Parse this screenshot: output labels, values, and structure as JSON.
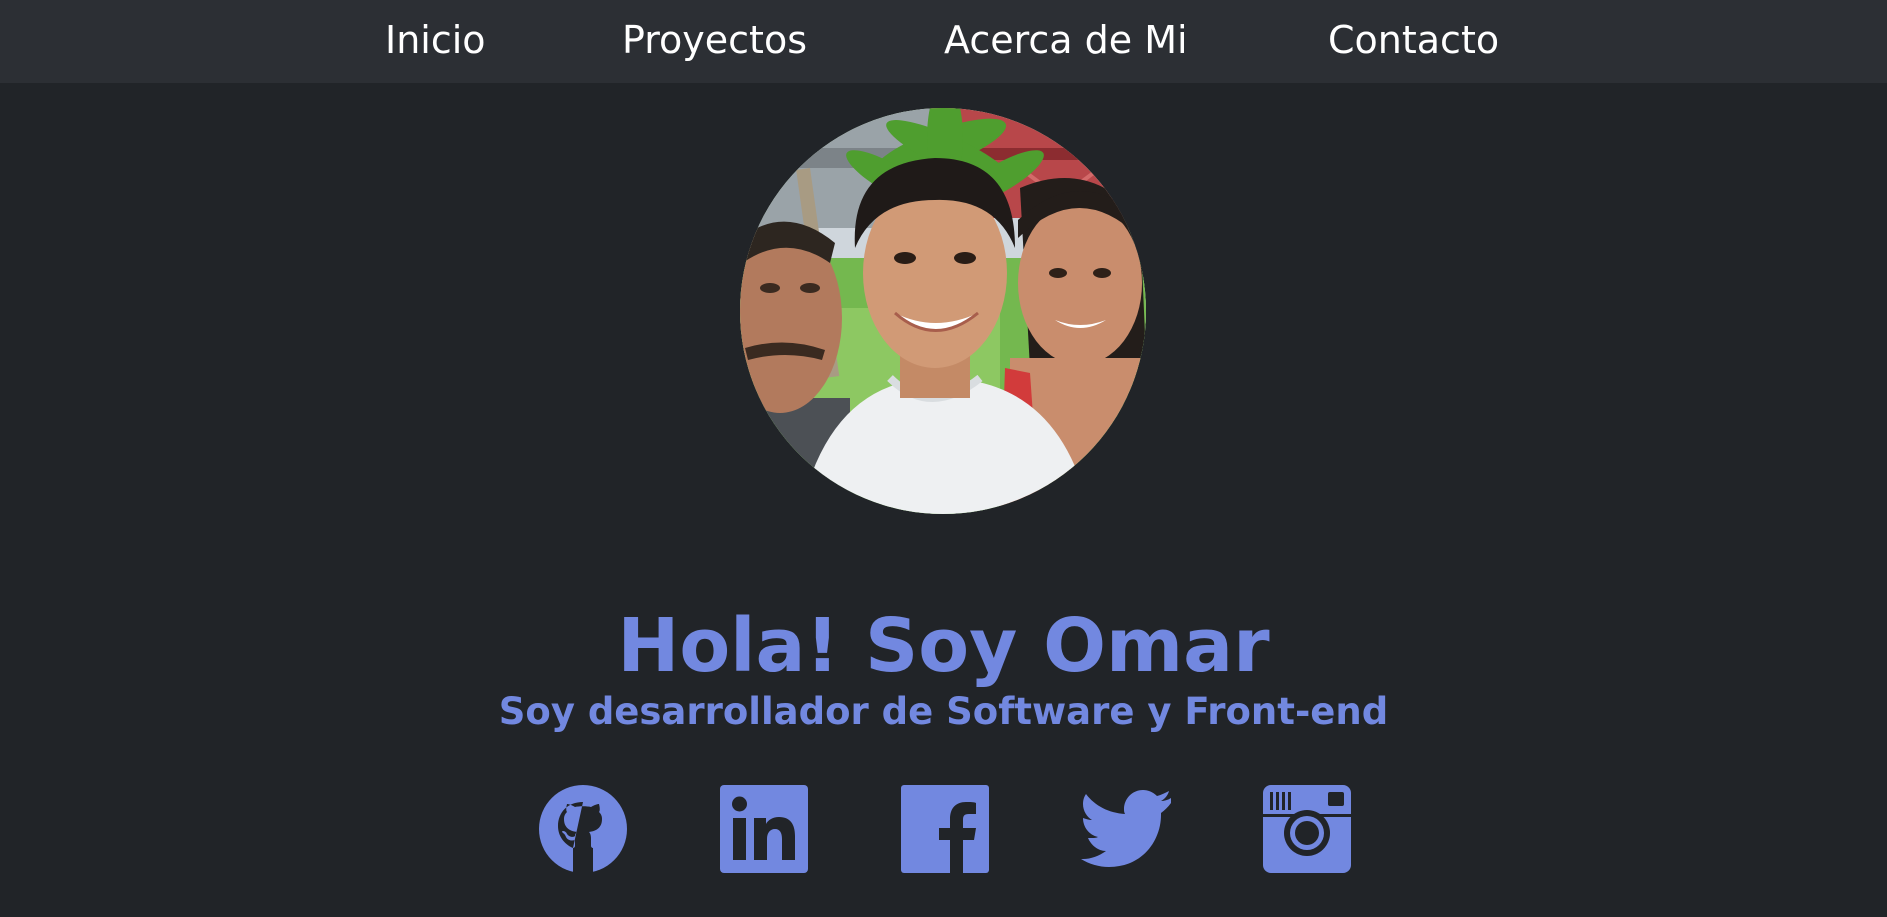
{
  "nav": {
    "items": [
      {
        "label": "Inicio"
      },
      {
        "label": "Proyectos"
      },
      {
        "label": "Acerca de Mi"
      },
      {
        "label": "Contacto"
      }
    ]
  },
  "hero": {
    "title": "Hola! Soy Omar",
    "subtitle": "Soy desarrollador de Software y Front-end"
  },
  "social": {
    "icons": [
      "github-icon",
      "linkedin-icon",
      "facebook-icon",
      "twitter-icon",
      "instagram-icon"
    ]
  },
  "colors": {
    "background": "#212428",
    "navbar": "#2c2f34",
    "accent": "#7288e0",
    "nav_text": "#ffffff"
  }
}
